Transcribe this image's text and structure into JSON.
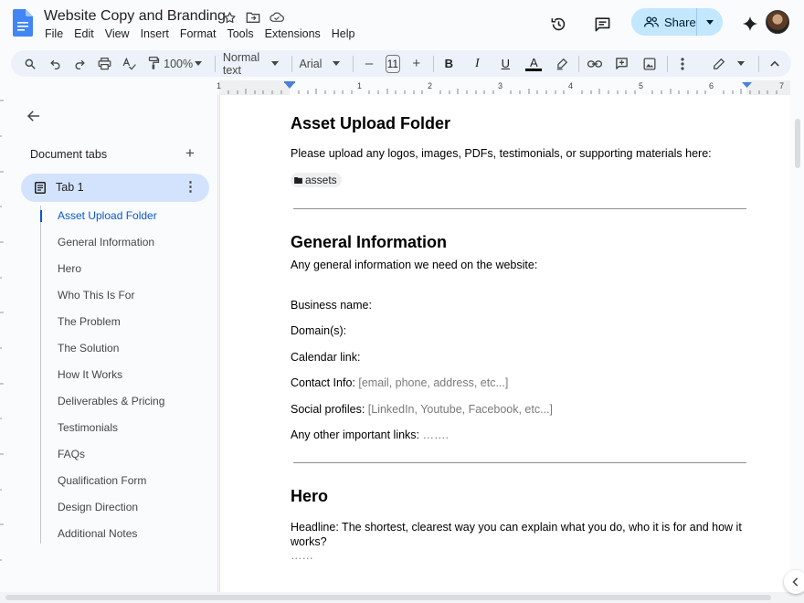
{
  "app": {
    "title": "Website Copy and Branding",
    "menus": [
      "File",
      "Edit",
      "View",
      "Insert",
      "Format",
      "Tools",
      "Extensions",
      "Help"
    ],
    "share_label": "Share",
    "accent": "#0b57d0",
    "share_bg": "#c2e7ff"
  },
  "toolbar": {
    "zoom": "100%",
    "style": "Normal text",
    "font": "Arial",
    "font_size": "11",
    "bold": "B",
    "italic": "I",
    "underline": "U",
    "text_color": "A",
    "minus": "–",
    "plus": "+"
  },
  "ruler": {
    "numbers": [
      "1",
      "1",
      "2",
      "3",
      "4",
      "5",
      "6",
      "7"
    ]
  },
  "sidebar": {
    "heading": "Document tabs",
    "add_symbol": "+",
    "tab_label": "Tab 1",
    "outline": [
      "Asset Upload Folder",
      "General Information",
      "Hero",
      "Who This Is For",
      "The Problem",
      "The Solution",
      "How It Works",
      "Deliverables & Pricing",
      "Testimonials",
      "FAQs",
      "Qualification Form",
      "Design Direction",
      "Additional Notes"
    ]
  },
  "document": {
    "section1": {
      "heading": "Asset Upload Folder",
      "text": "Please upload any logos, images, PDFs, testimonials, or supporting materials here:",
      "chip": "assets"
    },
    "section2": {
      "heading": "General Information",
      "intro": "Any general information we need on the website:",
      "business": "Business name:",
      "domain": "Domain(s):",
      "calendar": "Calendar link:",
      "contact_label": "Contact Info: ",
      "contact_ph": "[email, phone, address, etc...]",
      "social_label": "Social profiles: ",
      "social_ph": "[LinkedIn, Youtube, Facebook, etc...]",
      "links_label": "Any other important links: ",
      "links_ph": "……."
    },
    "section3": {
      "heading": "Hero",
      "headline_line1": "Headline: The shortest, clearest way you can explain what you do, who it is for and how it",
      "headline_line2": "works?",
      "dots": "……"
    }
  }
}
